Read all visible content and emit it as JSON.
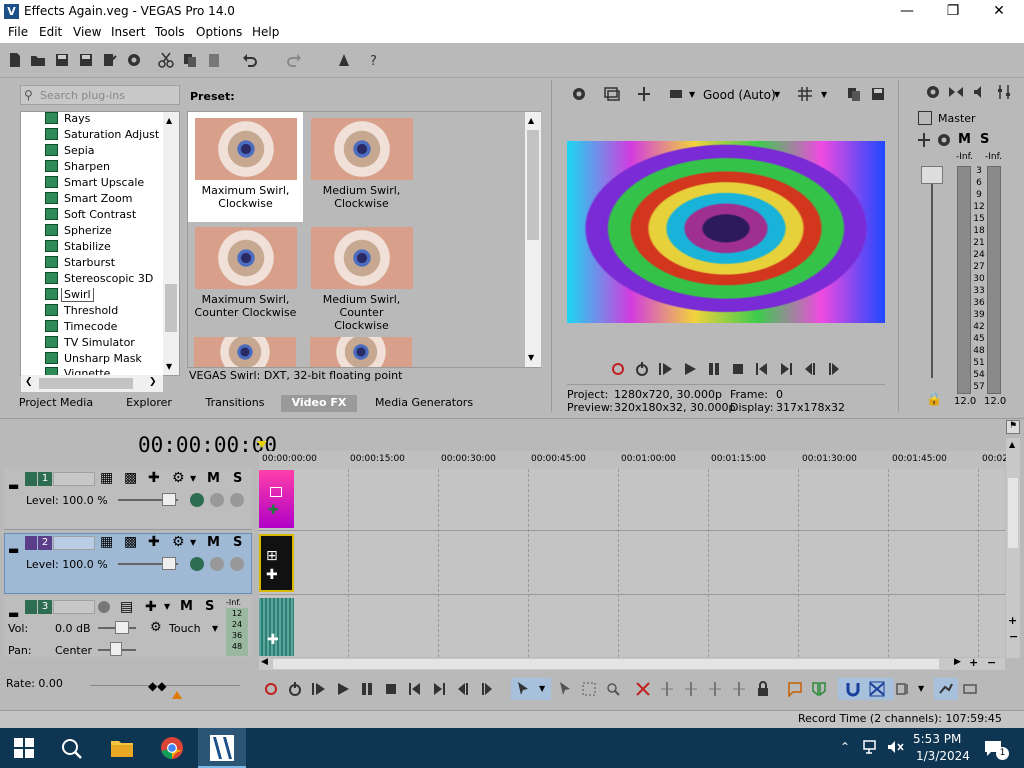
{
  "window": {
    "title": "Effects Again.veg - VEGAS Pro 14.0"
  },
  "menu": [
    "File",
    "Edit",
    "View",
    "Insert",
    "Tools",
    "Options",
    "Help"
  ],
  "plugins": {
    "search_placeholder": "Search plug-ins",
    "items": [
      "Rays",
      "Saturation Adjust",
      "Sepia",
      "Sharpen",
      "Smart Upscale",
      "Smart Zoom",
      "Soft Contrast",
      "Spherize",
      "Stabilize",
      "Starburst",
      "Stereoscopic 3D",
      "Swirl",
      "Threshold",
      "Timecode",
      "TV Simulator",
      "Unsharp Mask",
      "Vignette"
    ],
    "selected": "Swirl",
    "preset_label": "Preset:",
    "presets": [
      {
        "label1": "Maximum Swirl,",
        "label2": "Clockwise"
      },
      {
        "label1": "Medium Swirl,",
        "label2": "Clockwise"
      },
      {
        "label1": "Maximum Swirl,",
        "label2": "Counter Clockwise"
      },
      {
        "label1": "Medium Swirl, Counter",
        "label2": "Clockwise"
      }
    ],
    "description": "VEGAS Swirl: DXT, 32-bit floating point",
    "tabs": [
      "Project Media",
      "Explorer",
      "Transitions",
      "Video FX",
      "Media Generators"
    ],
    "active_tab": "Video FX"
  },
  "preview": {
    "quality": "Good (Auto)",
    "project_label": "Project:",
    "project_value": "1280x720, 30.000p",
    "preview_label": "Preview:",
    "preview_value": "320x180x32, 30.000p",
    "frame_label": "Frame:",
    "frame_value": "0",
    "display_label": "Display:",
    "display_value": "317x178x32"
  },
  "mixer": {
    "title": "Master",
    "m": "M",
    "s": "S",
    "inf_l": "-Inf.",
    "inf_r": "-Inf.",
    "scale": [
      "3",
      "6",
      "9",
      "12",
      "15",
      "18",
      "21",
      "24",
      "27",
      "30",
      "33",
      "36",
      "39",
      "42",
      "45",
      "48",
      "51",
      "54",
      "57"
    ],
    "fader_l": "12.0",
    "fader_r": "12.0"
  },
  "timeline": {
    "timecode": "00:00:00:00",
    "ruler": [
      "00:00:00:00",
      "00:00:15:00",
      "00:00:30:00",
      "00:00:45:00",
      "00:01:00:00",
      "00:01:15:00",
      "00:01:30:00",
      "00:01:45:00",
      "00:02"
    ],
    "tracks": [
      {
        "num": "1",
        "level": "Level: 100.0 %",
        "color": "#2d6e53"
      },
      {
        "num": "2",
        "level": "Level: 100.0 %",
        "color": "#5b3d8a"
      },
      {
        "num": "3",
        "vol_label": "Vol:",
        "vol_value": "0.0 dB",
        "pan_label": "Pan:",
        "pan_value": "Center",
        "mode": "Touch",
        "color": "#2d6e53",
        "inf": "-Inf.",
        "db": [
          "12",
          "24",
          "36",
          "48"
        ]
      }
    ],
    "m": "M",
    "s": "S",
    "rate": "Rate: 0.00"
  },
  "status": {
    "record_time": "Record Time (2 channels): 107:59:45"
  },
  "taskbar": {
    "time": "5:53 PM",
    "date": "1/3/2024",
    "notifications": "1"
  }
}
